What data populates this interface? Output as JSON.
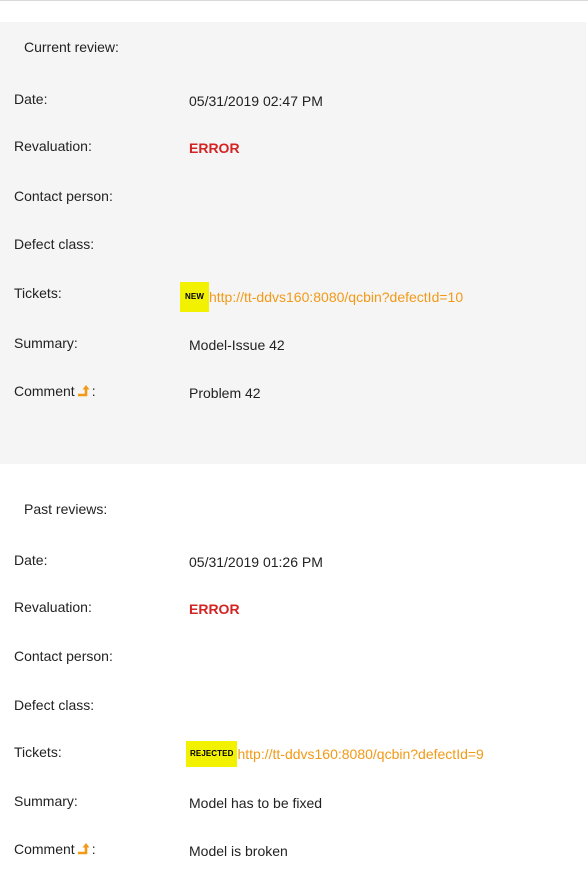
{
  "current": {
    "title": "Current review:",
    "date_label": "Date:",
    "date_value": "05/31/2019 02:47 PM",
    "revaluation_label": "Revaluation:",
    "revaluation_value": "ERROR",
    "contact_label": "Contact person:",
    "defect_label": "Defect class:",
    "tickets_label": "Tickets:",
    "ticket_badge": "NEW",
    "ticket_link": "http://tt-ddvs160:8080/qcbin?defectId=10",
    "summary_label": "Summary:",
    "summary_value": "Model-Issue 42",
    "comment_label": "Comment",
    "comment_suffix": ":",
    "comment_value": "Problem 42"
  },
  "past": {
    "title": "Past reviews:",
    "date_label": "Date:",
    "date_value": "05/31/2019 01:26 PM",
    "revaluation_label": "Revaluation:",
    "revaluation_value": "ERROR",
    "contact_label": "Contact person:",
    "defect_label": "Defect class:",
    "tickets_label": "Tickets:",
    "ticket_badge": "REJECTED",
    "ticket_link": "http://tt-ddvs160:8080/qcbin?defectId=9",
    "summary_label": "Summary:",
    "summary_value": "Model has to be fixed",
    "comment_label": "Comment",
    "comment_suffix": ":",
    "comment_value": "Model is broken"
  },
  "colors": {
    "error": "#d32424",
    "link": "#f29a17",
    "badge_bg": "#f2f200",
    "current_bg": "#f5f5f5",
    "comment_icon": "#f29a17"
  },
  "icons": {
    "comment": "turn-up-arrow-icon"
  }
}
